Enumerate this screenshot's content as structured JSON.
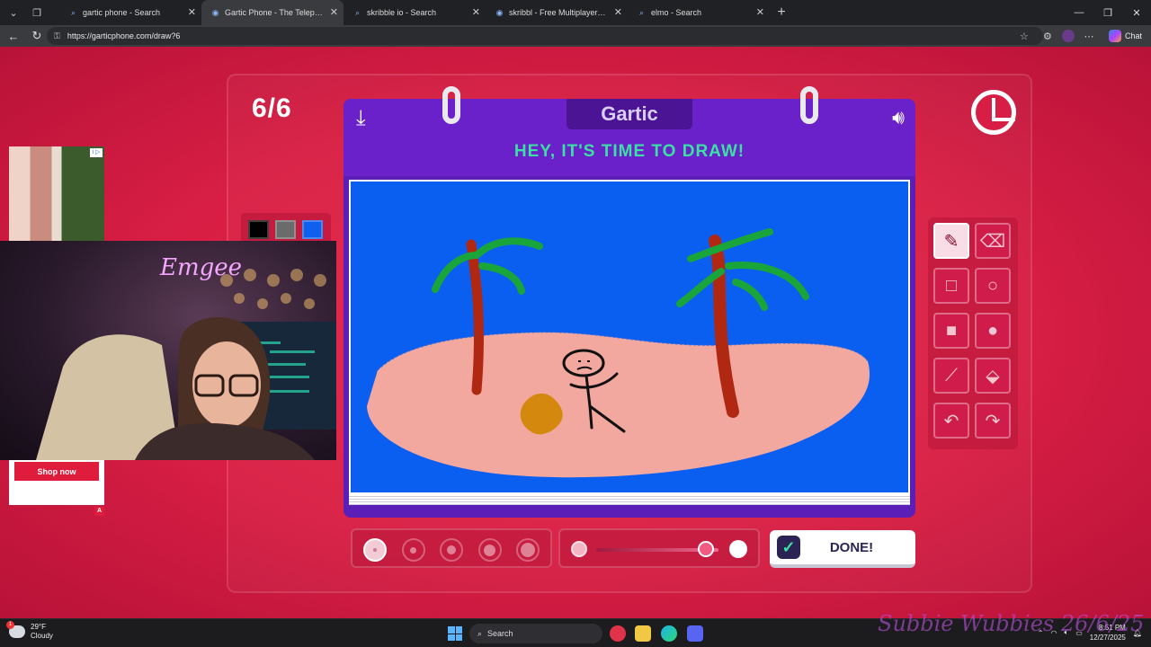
{
  "browser": {
    "tabs": [
      {
        "title": "gartic phone - Search",
        "icon": "search-icon",
        "active": false
      },
      {
        "title": "Gartic Phone - The Telephone Game",
        "icon": "gartic-favicon",
        "active": true
      },
      {
        "title": "skribble io - Search",
        "icon": "search-icon",
        "active": false
      },
      {
        "title": "skribbl - Free Multiplayer Drawing",
        "icon": "skribbl-favicon",
        "active": false
      },
      {
        "title": "elmo - Search",
        "icon": "search-icon",
        "active": false
      }
    ],
    "url": "https://garticphone.com/draw?6",
    "chat_label": "Chat"
  },
  "game": {
    "round": "6/6",
    "logo": "Gartic",
    "heading": "HEY, IT'S TIME TO DRAW!",
    "done_label": "DONE!",
    "palette_colors": [
      "#000000",
      "#6b6b6b",
      "#1060ee"
    ],
    "tools": [
      {
        "name": "pen-tool",
        "icon": "pencil-icon",
        "active": true
      },
      {
        "name": "eraser-tool",
        "icon": "eraser-icon",
        "active": false
      },
      {
        "name": "rectangle-outline-tool",
        "icon": "square-outline-icon",
        "active": false
      },
      {
        "name": "ellipse-outline-tool",
        "icon": "circle-outline-icon",
        "active": false
      },
      {
        "name": "rectangle-fill-tool",
        "icon": "square-filled-icon",
        "active": false
      },
      {
        "name": "ellipse-fill-tool",
        "icon": "circle-filled-icon",
        "active": false
      },
      {
        "name": "line-tool",
        "icon": "line-icon",
        "active": false
      },
      {
        "name": "fill-bucket-tool",
        "icon": "bucket-icon",
        "active": false
      },
      {
        "name": "undo-tool",
        "icon": "undo-icon",
        "active": false
      },
      {
        "name": "redo-tool",
        "icon": "redo-icon",
        "active": false
      }
    ],
    "brush_size_selected": 1,
    "brush_size_count": 5,
    "opacity_level": 0.9
  },
  "stream": {
    "ad_button": "Shop now",
    "ad_badge": "A",
    "ad_choices": "i ▷",
    "watermark": "Subbie Wubbies 26/6/25",
    "neon_sign": "Emgee"
  },
  "taskbar": {
    "temp": "29°F",
    "condition": "Cloudy",
    "weather_badge": "1",
    "search": "Search",
    "time": "8:51 PM",
    "date": "12/27/2025"
  }
}
